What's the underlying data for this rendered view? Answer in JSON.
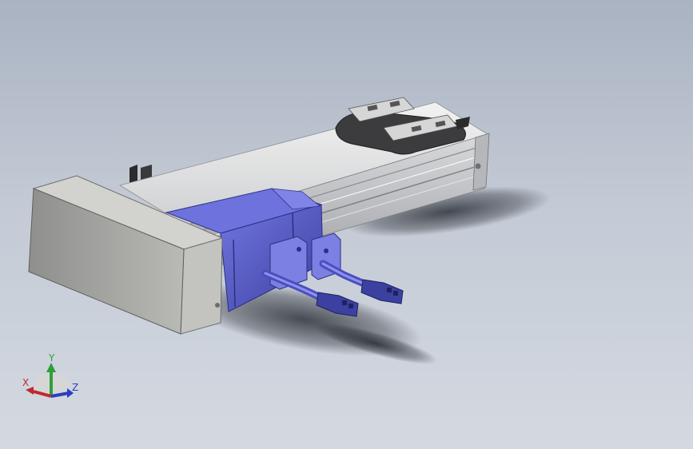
{
  "triad": {
    "x_label": "X",
    "y_label": "Y",
    "z_label": "Z",
    "x_color": "#c0282d",
    "y_color": "#2f9e3a",
    "z_color": "#2a3fbf"
  },
  "colors": {
    "background_top": "#aab3c2",
    "background_bottom": "#d4d9e1",
    "rail": "#d8d9db",
    "motor": "#5a5fd0",
    "motor_dark": "#3c40a0",
    "carriage": "#3a3a3a",
    "cover": "#c8c8c6"
  }
}
